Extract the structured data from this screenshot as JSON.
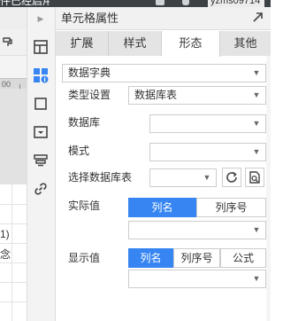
{
  "top_bar": {
    "left_text": "件已经启用",
    "right_text": "yzms09714"
  },
  "left_sheet": {
    "ruler_label": "00",
    "cell_rows": [
      "1)",
      "念"
    ]
  },
  "icon_sidebar": {
    "collapse_icon": "chevron-right-icon",
    "items": [
      {
        "icon": "cell-layout-icon",
        "selected": false
      },
      {
        "icon": "cell-properties-icon",
        "selected": true
      },
      {
        "icon": "square-icon",
        "selected": false
      },
      {
        "icon": "dropdown-box-icon",
        "selected": false
      },
      {
        "icon": "layers-icon",
        "selected": false
      },
      {
        "icon": "link-icon",
        "selected": false
      }
    ]
  },
  "panel": {
    "title": "单元格属性",
    "expand_icon": "expand-corner-icon",
    "tabs": [
      {
        "label": "扩展",
        "active": false
      },
      {
        "label": "样式",
        "active": false
      },
      {
        "label": "形态",
        "active": true
      },
      {
        "label": "其他",
        "active": false
      }
    ],
    "shape_type": {
      "value": "数据字典"
    },
    "type_setting": {
      "label": "类型设置",
      "value": "数据库表"
    },
    "database": {
      "label": "数据库",
      "value": ""
    },
    "schema": {
      "label": "模式",
      "value": ""
    },
    "select_table": {
      "label": "选择数据库表",
      "value": "",
      "refresh_icon": "refresh-icon",
      "preview_icon": "table-search-icon"
    },
    "actual_value": {
      "label": "实际值",
      "options": [
        {
          "label": "列名",
          "active": true
        },
        {
          "label": "列序号",
          "active": false
        }
      ],
      "value": ""
    },
    "display_value": {
      "label": "显示值",
      "options": [
        {
          "label": "列名",
          "active": true
        },
        {
          "label": "列序号",
          "active": false
        },
        {
          "label": "公式",
          "active": false
        }
      ],
      "value": ""
    }
  },
  "colors": {
    "accent": "#3685f2",
    "selected_icon": "#3685f2",
    "panel_header_bg": "#f1f1f1",
    "tabs_bg": "#e4e4e4"
  }
}
